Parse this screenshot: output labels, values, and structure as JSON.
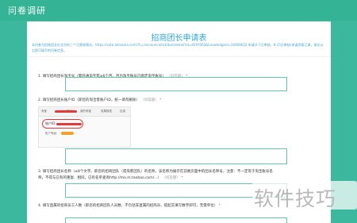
{
  "header": {
    "title": "问卷调研"
  },
  "form": {
    "title": "招商团长申请表",
    "intro": "本问卷为招商团长在北京的三个月营收情况，https://vote.alimama.com/?h=/announce/list/item/detail?id=8397063&knowledgeid=20469632 申请(1-7日审核，8-15日审核)申请资格已满，报名以后即可填写的问卷信息。",
    "questions": [
      {
        "number": "1.",
        "text": "填写招商团长淘宝号（需开通淘宝客≥6个月，且为淘宝账号已绑定淘宝账号）",
        "hint": "（问答题）",
        "required": "*"
      },
      {
        "number": "2.",
        "text": "填写招商团长账户ID（即您的淘宝客账户ID，统一请勿删除）",
        "hint": "（问答题）",
        "required": "*"
      },
      {
        "number": "3.",
        "text": "填写招商团长名称（≤8个文字。即您的招商团队（或淘客团队）的名称，该名称为展示在前端页面中的团长名称号，注意：不一定等于淘宝账号名称，不得与已有的重复、相同，已有名单查询http://mo.m.taobao.com/...）",
        "hint": "（问答题）",
        "required": "*"
      },
      {
        "number": "4.",
        "text": "填写直属的招商员工人数（即您的招商团队人员数、不包括非直属的招商员、提起实填写数字即可，无需单位）",
        "hint": "",
        "required": "*"
      }
    ]
  },
  "screenshot_example": {
    "nav_items": [
      "淘宝",
      "推广",
      "我的淘宝",
      "效果报表",
      "应用"
    ],
    "id_label": "账户ID：",
    "level_label": "账户等级："
  },
  "watermark": {
    "text": "软件技巧"
  },
  "colors": {
    "background": "#3bb89e",
    "accent_blue": "#2fa7d6",
    "input_border": "#63c9a3",
    "required": "#e05252"
  }
}
